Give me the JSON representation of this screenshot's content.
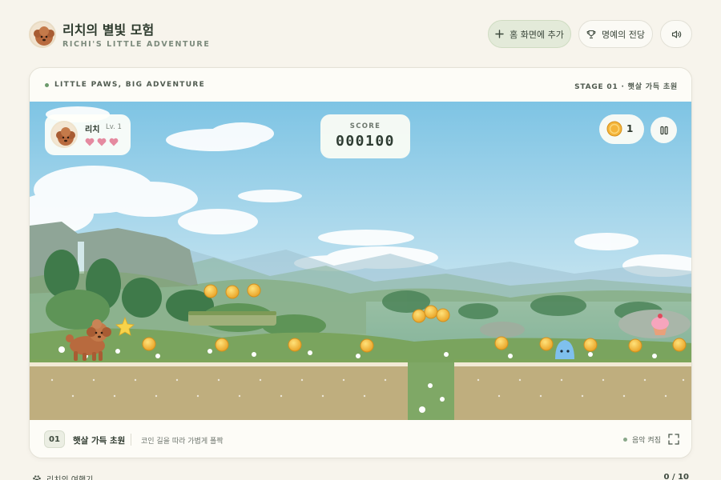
{
  "header": {
    "title": "리치의 별빛 모험",
    "subtitle": "RICHI'S LITTLE ADVENTURE",
    "buttons": {
      "add_home": "홈 화면에 추가",
      "hall_of_fame": "명예의 전당"
    }
  },
  "card": {
    "tagline": "LITTLE PAWS, BIG ADVENTURE",
    "stage_info": "STAGE 01 · 햇살 가득 초원"
  },
  "hud": {
    "player_name": "리치",
    "player_level": "Lv. 1",
    "hearts": 3,
    "score_label": "SCORE",
    "score": "000100",
    "coins": "1"
  },
  "footer": {
    "stage_number": "01",
    "stage_name": "햇살 가득 초원",
    "stage_desc": "코인 길을 따라 가볍게 폴짝",
    "music": "음악 켜짐"
  },
  "bottom": {
    "journal": "리치의 여행기",
    "journal_count": "0 / 10"
  },
  "colors": {
    "background": "#f7f4ec",
    "accent_green": "#6c9a6c",
    "primary_button": "#e3ead9",
    "heart": "#e58aa0",
    "coin": "#f4b43a",
    "ground": "#bfae7e",
    "sky_top": "#7ec4e4"
  },
  "icons": {
    "add": "plus-icon",
    "fame": "trophy-icon",
    "sound": "speaker-icon",
    "pause": "pause-icon",
    "fullscreen": "fullscreen-icon"
  }
}
